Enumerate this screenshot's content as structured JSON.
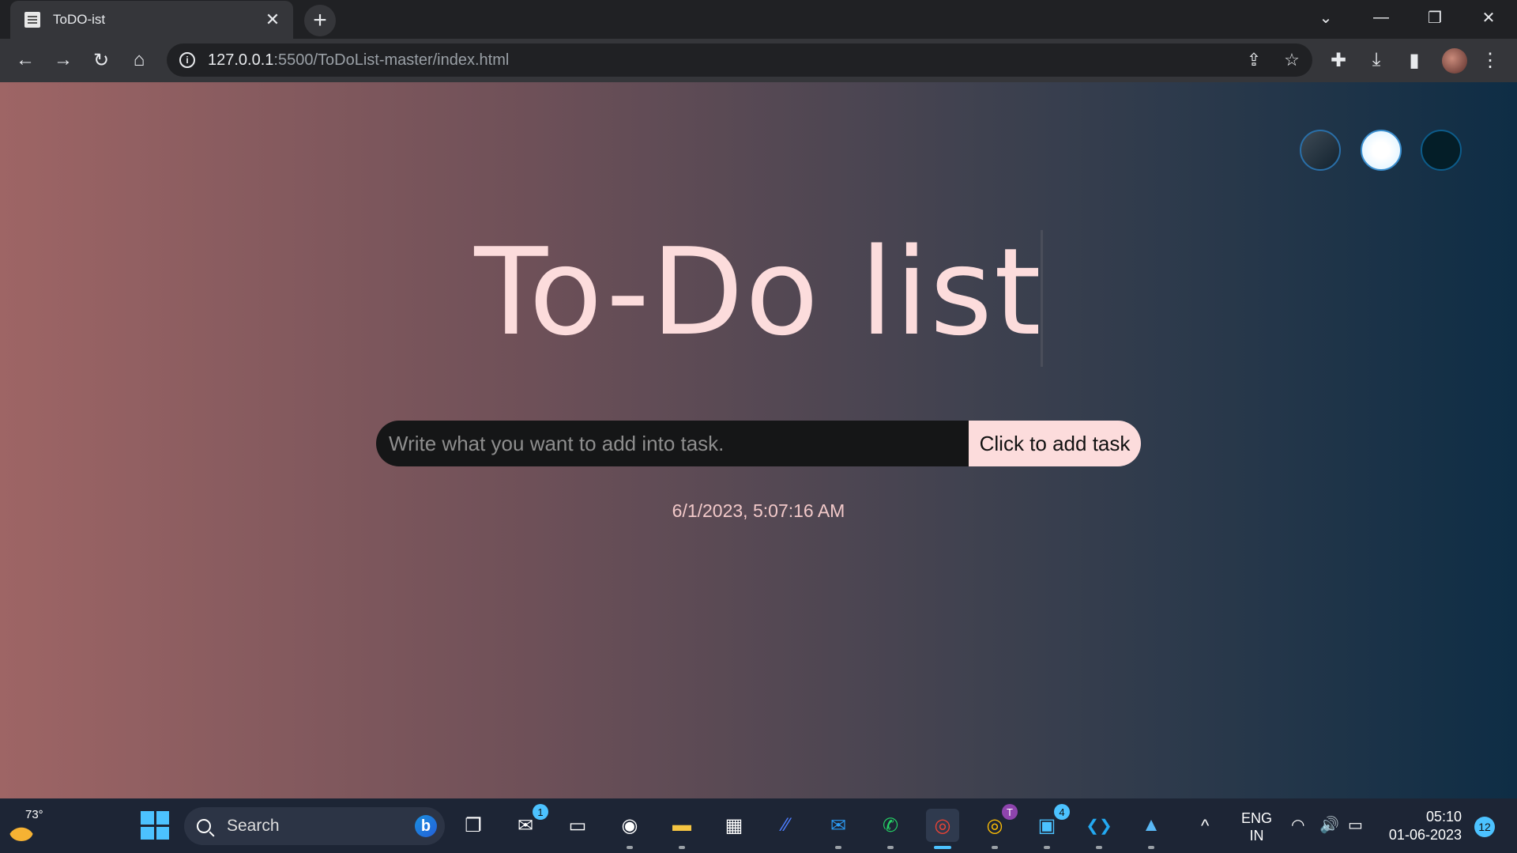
{
  "browser": {
    "tab_title": "ToDO-ist",
    "tab_close": "✕",
    "new_tab": "+",
    "url_host": "127.0.0.1",
    "url_rest": ":5500/ToDoList-master/index.html",
    "nav": {
      "back": "←",
      "forward": "→",
      "reload": "↻",
      "home": "⌂"
    },
    "omni_info": "i",
    "omni_actions": {
      "share": "⇪",
      "bookmark": "☆"
    },
    "toolbar_icons": {
      "extensions": "✚",
      "download": "⤓",
      "sidepanel": "▮",
      "menu": "⋮"
    },
    "window_controls": {
      "tab_search": "⌄",
      "minimize": "—",
      "restore": "❐",
      "close": "✕"
    }
  },
  "page": {
    "heading": "To-Do list",
    "input_placeholder": "Write what you want to add into task.",
    "add_button_label": "Click to add task",
    "datetime": "6/1/2023, 5:07:16 AM",
    "theme_selectors": [
      "standard-theme",
      "light-theme",
      "darker-theme"
    ]
  },
  "taskbar": {
    "weather_temp": "73°",
    "search_label": "Search",
    "bing_letter": "b",
    "apps": [
      {
        "name": "task-view",
        "glyph": "❐"
      },
      {
        "name": "teams",
        "glyph": "✉",
        "badge": "1"
      },
      {
        "name": "remote-desktop",
        "glyph": "▭"
      },
      {
        "name": "edge",
        "glyph": "◉"
      },
      {
        "name": "file-explorer",
        "glyph": "▬"
      },
      {
        "name": "microsoft-store",
        "glyph": "▦"
      },
      {
        "name": "app-store-blue",
        "glyph": "⁄⁄"
      },
      {
        "name": "mail",
        "glyph": "✉"
      },
      {
        "name": "whatsapp",
        "glyph": "✆"
      },
      {
        "name": "chrome",
        "glyph": "◎"
      },
      {
        "name": "chrome-profile",
        "glyph": "◎",
        "badge": "T"
      },
      {
        "name": "windows-app",
        "glyph": "▣",
        "badge": "4"
      },
      {
        "name": "vscode",
        "glyph": "❮❯"
      },
      {
        "name": "photos",
        "glyph": "▲"
      }
    ],
    "tray_chevron": "^",
    "lang_line1": "ENG",
    "lang_line2": "IN",
    "tray": {
      "wifi": "◠",
      "volume": "🔊",
      "battery": "▭"
    },
    "time": "05:10",
    "date": "01-06-2023",
    "notifications": "12"
  }
}
